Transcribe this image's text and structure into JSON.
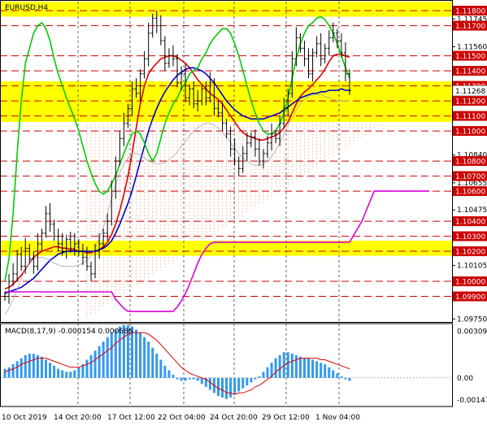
{
  "chart_data": [
    {
      "type": "line",
      "title": "EURUSD,H4",
      "x_labels": [
        "10 Oct 2019",
        "14 Oct 20:00",
        "17 Oct 12:00",
        "22 Oct 04:00",
        "24 Oct 20:00",
        "29 Oct 12:00",
        "1 Nov 04:00"
      ],
      "y_ticks": [
        "1.11745",
        "1.11560",
        "1.11268",
        "1.11195",
        "1.10840",
        "1.10655",
        "1.10475",
        "1.10290",
        "1.10105",
        "1.09750"
      ],
      "ylim": [
        1.0973,
        1.1186
      ],
      "levels": [
        {
          "value": 1.118,
          "label": "1.11800"
        },
        {
          "value": 1.117,
          "label": "1.11700"
        },
        {
          "value": 1.115,
          "label": "1.11500"
        },
        {
          "value": 1.114,
          "label": "1.11400"
        },
        {
          "value": 1.113,
          "label": "1.11300"
        },
        {
          "value": 1.112,
          "label": "1.11200"
        },
        {
          "value": 1.111,
          "label": "1.11100"
        },
        {
          "value": 1.11,
          "label": "1.11000"
        },
        {
          "value": 1.108,
          "label": "1.10800"
        },
        {
          "value": 1.107,
          "label": "1.10700"
        },
        {
          "value": 1.106,
          "label": "1.10600"
        },
        {
          "value": 1.104,
          "label": "1.10400"
        },
        {
          "value": 1.103,
          "label": "1.10300"
        },
        {
          "value": 1.102,
          "label": "1.10200"
        },
        {
          "value": 1.1,
          "label": "1.10000"
        },
        {
          "value": 1.099,
          "label": "1.09900"
        }
      ],
      "current_price": {
        "value": 1.11268,
        "label": "1.11268"
      },
      "zones": [
        {
          "from": 1.1176,
          "to": 1.1186
        },
        {
          "from": 1.1106,
          "to": 1.1133
        },
        {
          "from": 1.1017,
          "to": 1.1027
        }
      ],
      "series": [
        {
          "color": "#000000",
          "values": [
            1.099,
            1.1,
            1.1005,
            1.1018,
            1.101,
            1.1022,
            1.1015,
            1.101,
            1.1025,
            1.1032,
            1.1045,
            1.1038,
            1.103,
            1.1025,
            1.102,
            1.1028,
            1.1022,
            1.1025,
            1.102,
            1.1016,
            1.101,
            1.1005,
            1.102,
            1.1025,
            1.1032,
            1.104,
            1.106,
            1.108,
            1.1095,
            1.1105,
            1.1115,
            1.1128,
            1.1125,
            1.1138,
            1.1148,
            1.1165,
            1.1175,
            1.117,
            1.116,
            1.1145,
            1.115,
            1.1148,
            1.1132,
            1.1138,
            1.1122,
            1.1128,
            1.1118,
            1.112,
            1.1128,
            1.1122,
            1.1132,
            1.1115,
            1.1112,
            1.1105,
            1.1098,
            1.1088,
            1.108,
            1.1075,
            1.1085,
            1.1092,
            1.1096,
            1.1088,
            1.108,
            1.1085,
            1.1092,
            1.1098,
            1.1095,
            1.1105,
            1.1115,
            1.1125,
            1.1148,
            1.1162,
            1.1155,
            1.1148,
            1.1138,
            1.1152,
            1.1158,
            1.1148,
            1.1155,
            1.1162,
            1.1165,
            1.116,
            1.1152,
            1.1138,
            1.1127
          ]
        },
        {
          "color": "#dd0000",
          "values": [
            1.0995,
            1.0996,
            1.0998,
            1.1001,
            1.1004,
            1.1008,
            1.1012,
            1.1016,
            1.1018,
            1.102,
            1.1021,
            1.1022,
            1.1023,
            1.1023,
            1.1022,
            1.1022,
            1.1021,
            1.1021,
            1.102,
            1.102,
            1.1019,
            1.1019,
            1.102,
            1.1021,
            1.1023,
            1.1026,
            1.1031,
            1.1038,
            1.1047,
            1.1058,
            1.107,
            1.1085,
            1.1102,
            1.1118,
            1.113,
            1.1138,
            1.1142,
            1.1145,
            1.1148,
            1.1149,
            1.115,
            1.115,
            1.1149,
            1.1147,
            1.1145,
            1.1142,
            1.1138,
            1.1134,
            1.1131,
            1.1128,
            1.1125,
            1.1123,
            1.1121,
            1.1118,
            1.1114,
            1.111,
            1.1106,
            1.1102,
            1.1099,
            1.1097,
            1.1096,
            1.1095,
            1.1094,
            1.1094,
            1.1095,
            1.1096,
            1.1097,
            1.1099,
            1.1102,
            1.1106,
            1.1112,
            1.1118,
            1.1123,
            1.1126,
            1.1128,
            1.1131,
            1.1134,
            1.1137,
            1.1141,
            1.1146,
            1.115,
            1.1151,
            1.1151,
            1.115,
            1.1149
          ]
        },
        {
          "color": "#0000cc",
          "values": [
            1.0992,
            1.0993,
            1.0994,
            1.0995,
            1.0996,
            1.0998,
            1.1,
            1.1002,
            1.1005,
            1.1008,
            1.1011,
            1.1014,
            1.1016,
            1.1018,
            1.1019,
            1.102,
            1.102,
            1.102,
            1.102,
            1.102,
            1.102,
            1.102,
            1.102,
            1.1021,
            1.1022,
            1.1024,
            1.1027,
            1.1032,
            1.1038,
            1.1045,
            1.1052,
            1.106,
            1.107,
            1.108,
            1.109,
            1.11,
            1.1108,
            1.1115,
            1.1121,
            1.1126,
            1.113,
            1.1134,
            1.1137,
            1.1139,
            1.1141,
            1.1142,
            1.1142,
            1.1141,
            1.114,
            1.1138,
            1.1135,
            1.1132,
            1.1128,
            1.1124,
            1.112,
            1.1117,
            1.1114,
            1.1112,
            1.111,
            1.1109,
            1.1108,
            1.1108,
            1.1108,
            1.1108,
            1.1109,
            1.111,
            1.1111,
            1.1112,
            1.1114,
            1.1116,
            1.1118,
            1.112,
            1.1122,
            1.1123,
            1.1124,
            1.1125,
            1.1125,
            1.1126,
            1.1126,
            1.1127,
            1.1127,
            1.1127,
            1.1128,
            1.1127,
            1.1127
          ]
        },
        {
          "color": "#00cc00",
          "values": [
            1.1,
            1.1015,
            1.1045,
            1.1085,
            1.112,
            1.1145,
            1.1155,
            1.1165,
            1.117,
            1.1172,
            1.1168,
            1.116,
            1.1148,
            1.1138,
            1.113,
            1.1122,
            1.1115,
            1.1108,
            1.11,
            1.109,
            1.108,
            1.1072,
            1.1065,
            1.106,
            1.1058,
            1.106,
            1.1065,
            1.107,
            1.1078,
            1.1085,
            1.1092,
            1.1098,
            1.11,
            1.1098,
            1.1092,
            1.1085,
            1.108,
            1.1085,
            1.1095,
            1.1105,
            1.1112,
            1.1118,
            1.1122,
            1.1128,
            1.1132,
            1.1138,
            1.114,
            1.1142,
            1.1148,
            1.1152,
            1.1158,
            1.1162,
            1.1165,
            1.1168,
            1.1168,
            1.1165,
            1.1158,
            1.115,
            1.114,
            1.113,
            1.112,
            1.1112,
            1.1105,
            1.11,
            1.1098,
            1.1098,
            1.11,
            1.1105,
            1.1112,
            1.1122,
            1.1135,
            1.1148,
            1.1158,
            1.1165,
            1.117,
            1.1172,
            1.1175,
            1.1176,
            1.1174,
            1.117,
            1.1165,
            1.1158,
            1.115,
            1.1142,
            1.1135
          ]
        },
        {
          "color": "#aaaaaa",
          "values": [
            1.0978,
            1.0982,
            1.0988,
            1.0995,
            1.1002,
            1.1008,
            1.1012,
            1.1015,
            1.1016,
            1.1016,
            1.1015,
            1.1014,
            1.1012,
            1.1011,
            1.101,
            1.101,
            1.101,
            1.101,
            1.1011,
            1.1012,
            1.1014,
            1.1017,
            1.1022,
            1.1028,
            1.1036,
            1.1045,
            1.1055,
            1.1064,
            1.1072,
            1.1078,
            1.1082,
            1.1085,
            1.1085,
            1.1084,
            1.1082,
            1.108,
            1.1079,
            1.1078,
            1.1078,
            1.1079,
            1.1081,
            1.1083,
            1.1086,
            1.109,
            1.1093,
            1.1097,
            1.11,
            1.1102,
            1.1104,
            1.1105,
            1.1105,
            1.1104,
            1.1102,
            1.1099,
            1.1096,
            1.1092,
            1.1088,
            1.1085,
            1.1082,
            1.108,
            1.1078,
            1.1077,
            1.1077,
            1.1078,
            1.108,
            1.1083,
            1.1087,
            1.1092,
            1.1098,
            1.1104,
            1.1109,
            1.1114,
            1.1118,
            1.1121,
            1.1123,
            1.1124,
            1.1124,
            1.1124,
            1.1123,
            1.1122,
            1.1121,
            1.112,
            1.112,
            1.112,
            1.112
          ]
        },
        {
          "color": "#dd00dd",
          "values": [
            1.0993,
            1.0993,
            1.0993,
            1.0993,
            1.0993,
            1.0993,
            1.0993,
            1.0993,
            1.0993,
            1.0993,
            1.0993,
            1.0993,
            1.0993,
            1.0993,
            1.0993,
            1.0993,
            1.0993,
            1.0993,
            1.0993,
            1.0993,
            1.0993,
            1.0993,
            1.0993,
            1.0993,
            1.0993,
            1.0993,
            1.0993,
            1.0988,
            1.0985,
            1.0982,
            1.098,
            1.098,
            1.098,
            1.098,
            1.098,
            1.098,
            1.098,
            1.098,
            1.098,
            1.098,
            1.098,
            1.098,
            1.0983,
            1.0987,
            1.0992,
            1.0998,
            1.1005,
            1.1012,
            1.1018,
            1.1022,
            1.1025,
            1.1026,
            1.1026,
            1.1026,
            1.1026,
            1.1026,
            1.1026,
            1.1026,
            1.1026,
            1.1026,
            1.1026,
            1.1026,
            1.1026,
            1.1026,
            1.1026,
            1.1026,
            1.1026,
            1.1026,
            1.1026,
            1.1026,
            1.1026,
            1.1026,
            1.1026,
            1.1026,
            1.1026,
            1.1026,
            1.1026,
            1.1026,
            1.1026,
            1.1026,
            1.1026,
            1.1026,
            1.1026,
            1.1026,
            1.1026
          ]
        }
      ]
    },
    {
      "type": "bar",
      "title": "MACD(8,17,9) -0.000154 0.000686",
      "y_ticks": [
        "0.00309",
        "0.00",
        "-0.001475"
      ],
      "ylim": [
        -0.0019,
        0.0036
      ],
      "values": [
        0.0006,
        0.0007,
        0.0009,
        0.0011,
        0.0013,
        0.0015,
        0.0016,
        0.0016,
        0.0015,
        0.0014,
        0.0012,
        0.001,
        0.0008,
        0.0006,
        0.0005,
        0.0004,
        0.0004,
        0.0005,
        0.0007,
        0.0009,
        0.0012,
        0.0015,
        0.0018,
        0.0021,
        0.0024,
        0.0027,
        0.003,
        0.0032,
        0.0034,
        0.0035,
        0.0035,
        0.0034,
        0.0032,
        0.003,
        0.0027,
        0.0024,
        0.002,
        0.0016,
        0.0012,
        0.0008,
        0.0005,
        0.0002,
        -0.0001,
        -0.0002,
        -0.0002,
        -0.0001,
        -0.0001,
        -0.0002,
        -0.0004,
        -0.0006,
        -0.0008,
        -0.001,
        -0.0012,
        -0.0013,
        -0.0014,
        -0.0013,
        -0.0011,
        -0.0009,
        -0.0007,
        -0.0005,
        -0.0003,
        -0.0001,
        0.0001,
        0.0004,
        0.0007,
        0.001,
        0.0013,
        0.0015,
        0.0017,
        0.0017,
        0.0016,
        0.0015,
        0.0014,
        0.0013,
        0.0013,
        0.0012,
        0.0011,
        0.001,
        0.0009,
        0.0007,
        0.0005,
        0.0003,
        0.0001,
        -0.0001,
        -0.0002
      ],
      "signal": {
        "color": "#dd0000",
        "values": [
          0.0004,
          0.0005,
          0.0006,
          0.0007,
          0.0009,
          0.001,
          0.0011,
          0.0012,
          0.0013,
          0.0013,
          0.0013,
          0.0012,
          0.0011,
          0.001,
          0.0009,
          0.0008,
          0.0007,
          0.0007,
          0.0007,
          0.0008,
          0.0009,
          0.001,
          0.0012,
          0.0014,
          0.0016,
          0.0018,
          0.002,
          0.0023,
          0.0025,
          0.0027,
          0.0029,
          0.003,
          0.003,
          0.003,
          0.003,
          0.0029,
          0.0027,
          0.0025,
          0.0022,
          0.0019,
          0.0016,
          0.0013,
          0.001,
          0.0007,
          0.0005,
          0.0003,
          0.0002,
          0.0001,
          0,
          -0.0001,
          -0.0003,
          -0.0005,
          -0.0007,
          -0.0008,
          -0.001,
          -0.001,
          -0.0011,
          -0.001,
          -0.001,
          -0.0009,
          -0.0008,
          -0.0006,
          -0.0005,
          -0.0003,
          -0.0001,
          0.0001,
          0.0004,
          0.0006,
          0.0008,
          0.001,
          0.0011,
          0.0012,
          0.0013,
          0.0013,
          0.0013,
          0.0013,
          0.0013,
          0.0012,
          0.0012,
          0.0011,
          0.001,
          0.0009,
          0.0008,
          0.0007,
          0.0006
        ]
      }
    }
  ]
}
